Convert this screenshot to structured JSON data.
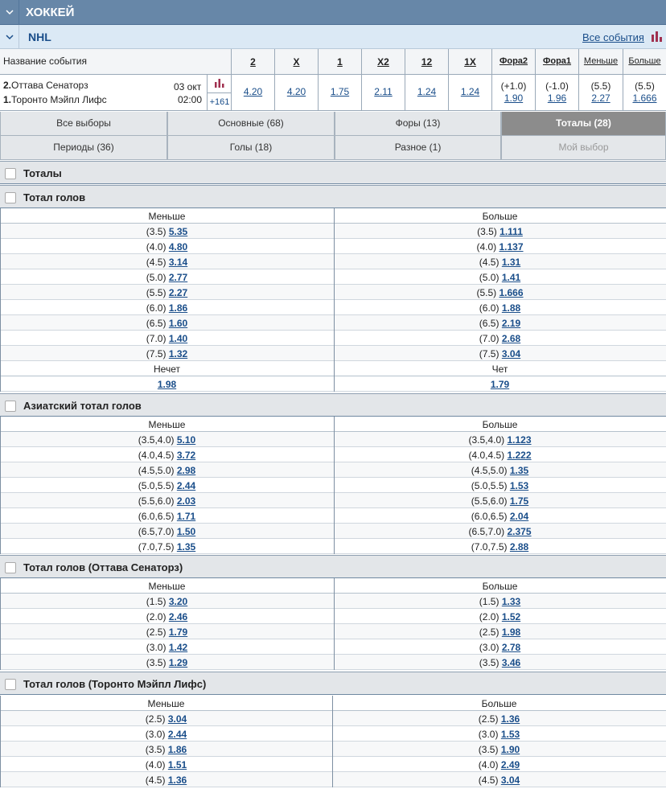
{
  "sport": {
    "title": "ХОККЕЙ"
  },
  "league": {
    "title": "NHL",
    "all_events": "Все события"
  },
  "columns": {
    "name": "Название события",
    "items": [
      "2",
      "X",
      "1",
      "X2",
      "12",
      "1X",
      "Фора2",
      "Фора1",
      "Меньше",
      "Больше"
    ]
  },
  "event": {
    "team1_num": "2.",
    "team1": "Оттава Сенаторз",
    "team2_num": "1.",
    "team2": "Торонто Мэйпл Лифс",
    "date": "03 окт",
    "time": "02:00",
    "more": "+161",
    "odds": [
      "4.20",
      "4.20",
      "1.75",
      "2.11",
      "1.24",
      "1.24"
    ],
    "extra": [
      {
        "par": "(+1.0)",
        "val": "1.90"
      },
      {
        "par": "(-1.0)",
        "val": "1.96"
      },
      {
        "par": "(5.5)",
        "val": "2.27"
      },
      {
        "par": "(5.5)",
        "val": "1.666"
      }
    ]
  },
  "tabs_row1": [
    "Все выборы",
    "Основные (68)",
    "Форы (13)",
    "Тоталы (28)"
  ],
  "tabs_row2": [
    "Периоды (36)",
    "Голы (18)",
    "Разное (1)",
    "Мой выбор"
  ],
  "sections": {
    "totals": "Тоталы",
    "total_goals": {
      "title": "Тотал голов",
      "less": "Меньше",
      "more": "Больше",
      "rows": [
        [
          "(3.5)",
          "5.35",
          "(3.5)",
          "1.111"
        ],
        [
          "(4.0)",
          "4.80",
          "(4.0)",
          "1.137"
        ],
        [
          "(4.5)",
          "3.14",
          "(4.5)",
          "1.31"
        ],
        [
          "(5.0)",
          "2.77",
          "(5.0)",
          "1.41"
        ],
        [
          "(5.5)",
          "2.27",
          "(5.5)",
          "1.666"
        ],
        [
          "(6.0)",
          "1.86",
          "(6.0)",
          "1.88"
        ],
        [
          "(6.5)",
          "1.60",
          "(6.5)",
          "2.19"
        ],
        [
          "(7.0)",
          "1.40",
          "(7.0)",
          "2.68"
        ],
        [
          "(7.5)",
          "1.32",
          "(7.5)",
          "3.04"
        ]
      ],
      "odd_label": "Нечет",
      "even_label": "Чет",
      "odd_val": "1.98",
      "even_val": "1.79"
    },
    "asian": {
      "title": "Азиатский тотал голов",
      "less": "Меньше",
      "more": "Больше",
      "rows": [
        [
          "(3.5,4.0)",
          "5.10",
          "(3.5,4.0)",
          "1.123"
        ],
        [
          "(4.0,4.5)",
          "3.72",
          "(4.0,4.5)",
          "1.222"
        ],
        [
          "(4.5,5.0)",
          "2.98",
          "(4.5,5.0)",
          "1.35"
        ],
        [
          "(5.0,5.5)",
          "2.44",
          "(5.0,5.5)",
          "1.53"
        ],
        [
          "(5.5,6.0)",
          "2.03",
          "(5.5,6.0)",
          "1.75"
        ],
        [
          "(6.0,6.5)",
          "1.71",
          "(6.0,6.5)",
          "2.04"
        ],
        [
          "(6.5,7.0)",
          "1.50",
          "(6.5,7.0)",
          "2.375"
        ],
        [
          "(7.0,7.5)",
          "1.35",
          "(7.0,7.5)",
          "2.88"
        ]
      ]
    },
    "ottawa": {
      "title": "Тотал голов (Оттава Сенаторз)",
      "less": "Меньше",
      "more": "Больше",
      "rows": [
        [
          "(1.5)",
          "3.20",
          "(1.5)",
          "1.33"
        ],
        [
          "(2.0)",
          "2.46",
          "(2.0)",
          "1.52"
        ],
        [
          "(2.5)",
          "1.79",
          "(2.5)",
          "1.98"
        ],
        [
          "(3.0)",
          "1.42",
          "(3.0)",
          "2.78"
        ],
        [
          "(3.5)",
          "1.29",
          "(3.5)",
          "3.46"
        ]
      ]
    },
    "toronto": {
      "title": "Тотал голов (Торонто Мэйпл Лифс)",
      "less": "Меньше",
      "more": "Больше",
      "rows": [
        [
          "(2.5)",
          "3.04",
          "(2.5)",
          "1.36"
        ],
        [
          "(3.0)",
          "2.44",
          "(3.0)",
          "1.53"
        ],
        [
          "(3.5)",
          "1.86",
          "(3.5)",
          "1.90"
        ],
        [
          "(4.0)",
          "1.51",
          "(4.0)",
          "2.49"
        ],
        [
          "(4.5)",
          "1.36",
          "(4.5)",
          "3.04"
        ]
      ]
    }
  },
  "colors": {
    "header_bg": "#6787a8",
    "league_bg": "#dbe9f5",
    "link": "#1a4e8a",
    "active_tab": "#8c8c8c",
    "stat_icon": "#a0304f"
  }
}
